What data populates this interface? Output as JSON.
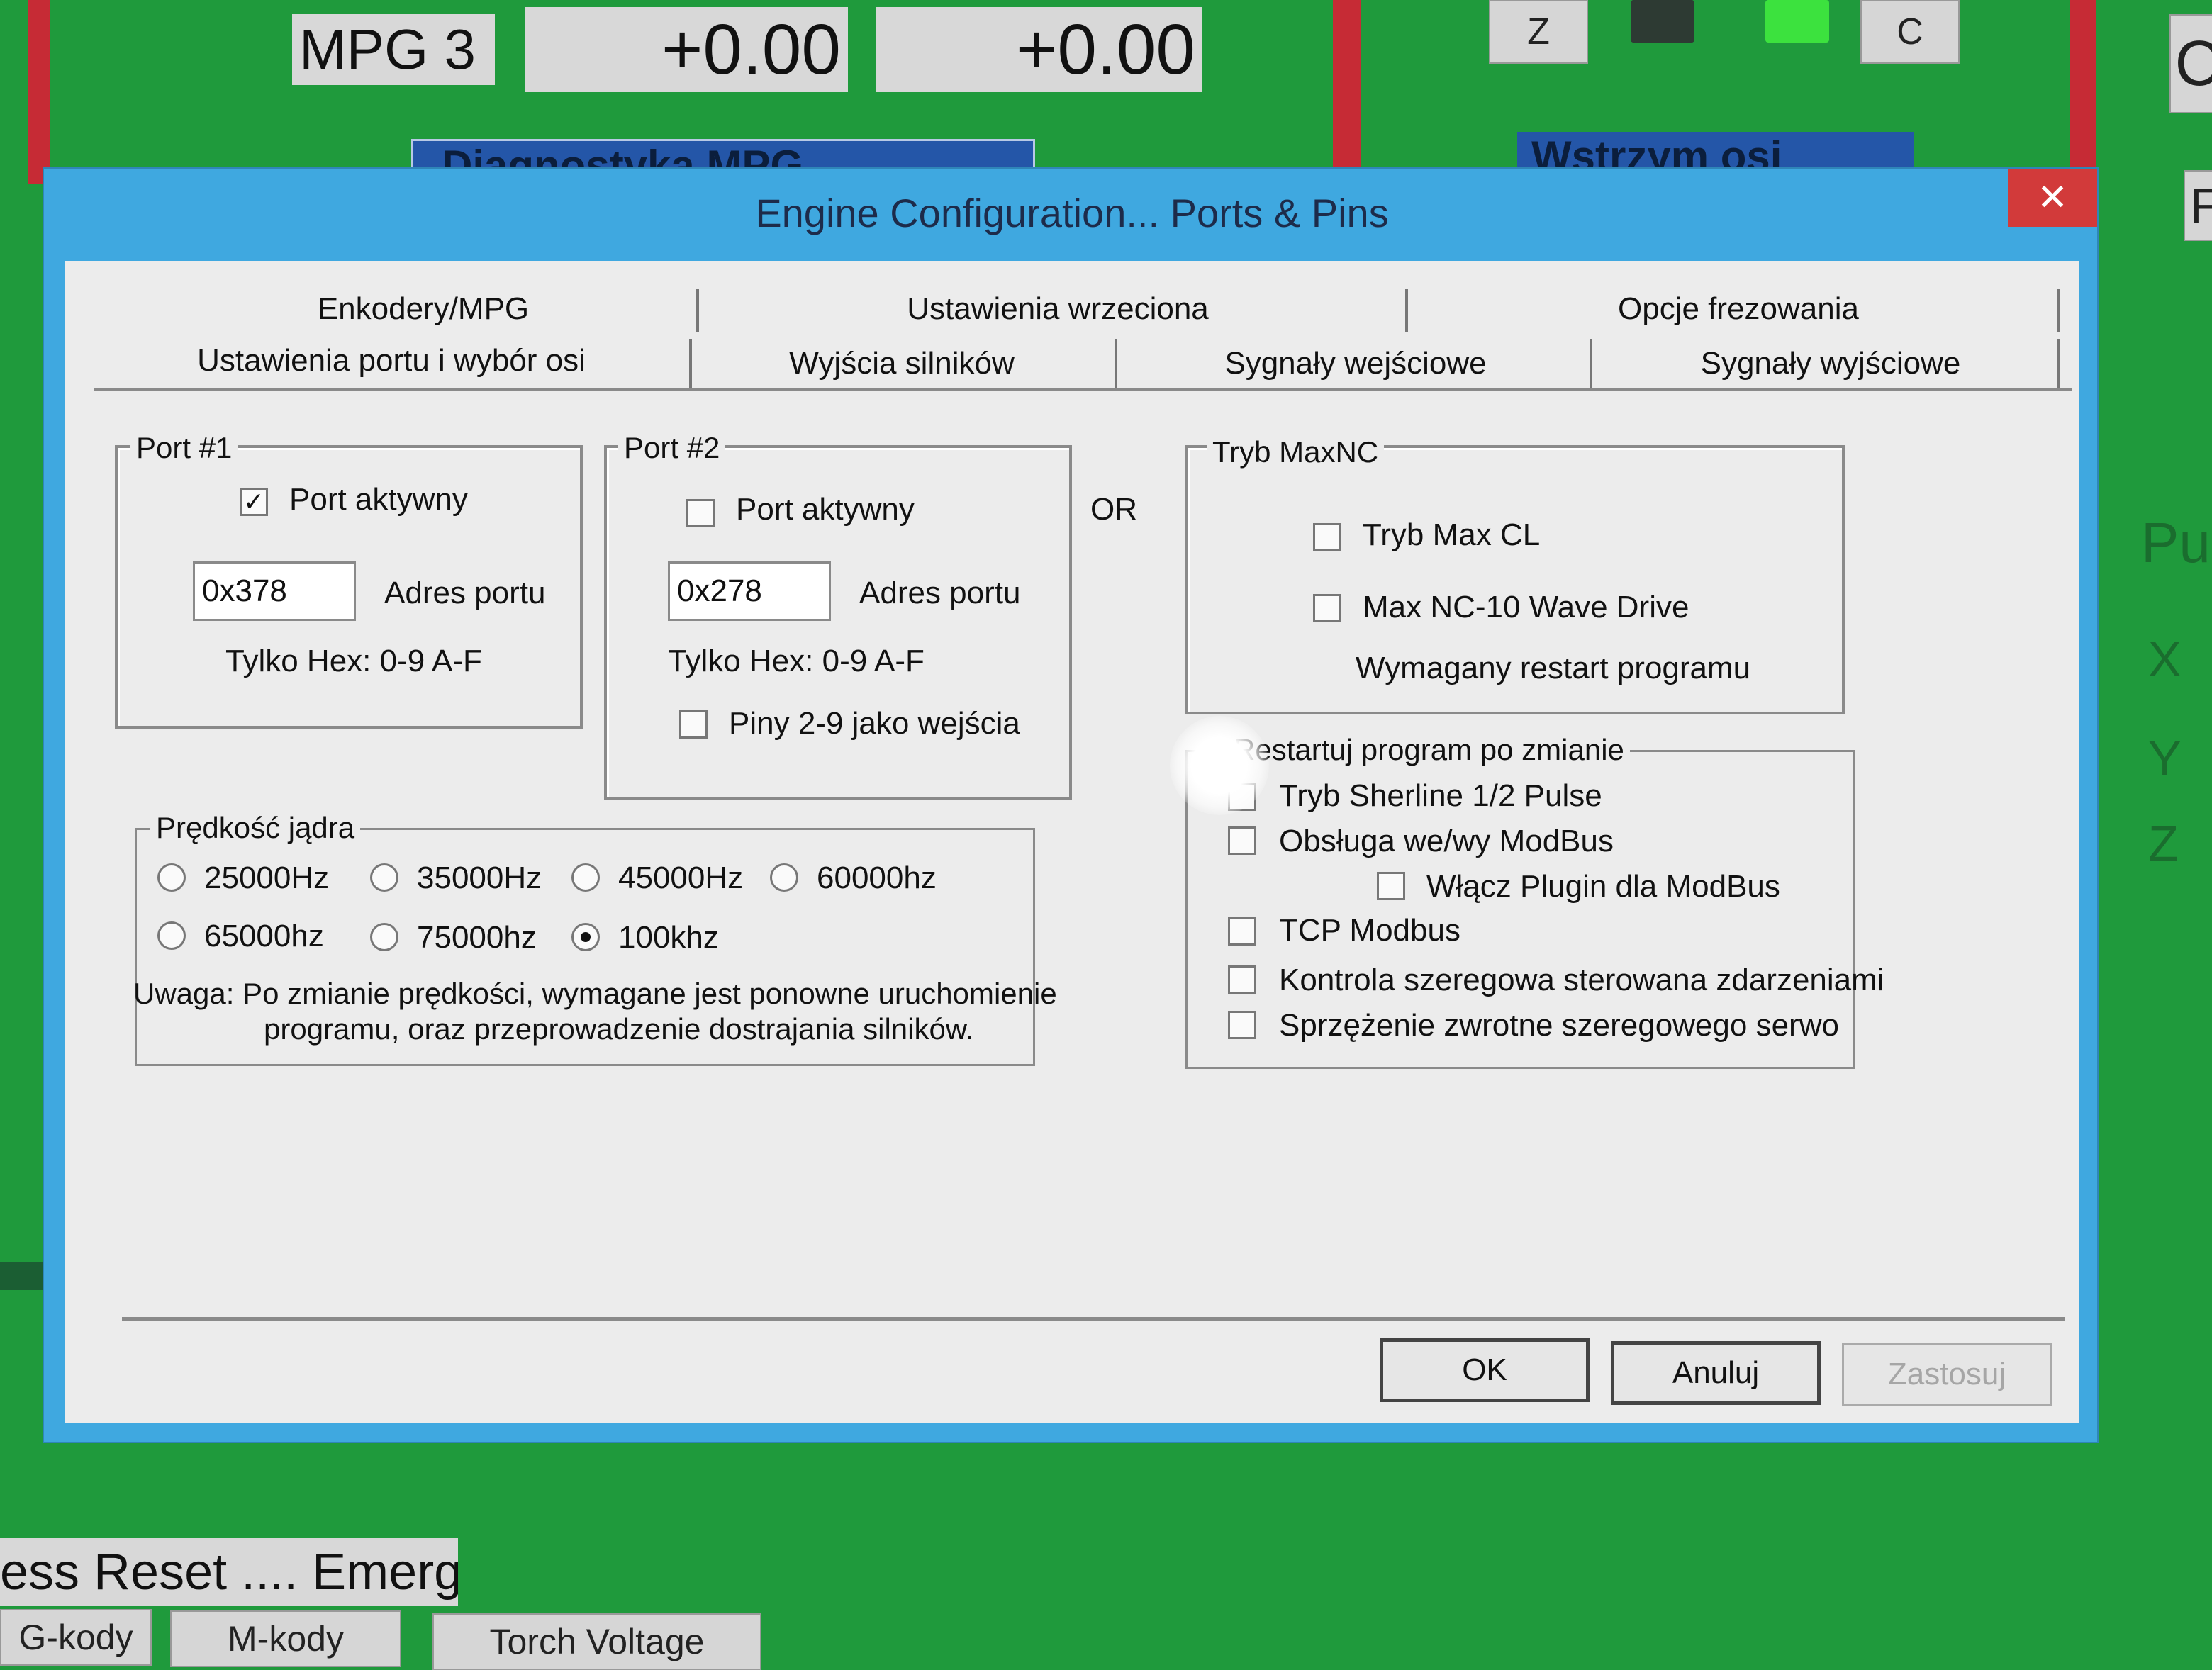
{
  "background": {
    "mpg_label": "MPG 3",
    "value_1": "+0.00",
    "value_2": "+0.00",
    "btn_z": "Z",
    "btn_c": "C",
    "header_1": "Diagnostyka MPG",
    "header_2": "Wstrzym osi",
    "right_label": "Pu",
    "axis_x": "X",
    "axis_y": "Y",
    "axis_z": "Z",
    "status_text": "ess Reset .... Emerg",
    "tabs": [
      "G-kody",
      "M-kody",
      "Torch Voltage"
    ],
    "right_top_char": "C",
    "right_mid_char": "F"
  },
  "dialog": {
    "title": "Engine Configuration... Ports & Pins",
    "close_glyph": "✕",
    "tabs_row1": [
      "Enkodery/MPG",
      "Ustawienia wrzeciona",
      "Opcje frezowania"
    ],
    "tabs_row2": [
      "Ustawienia portu i wybór osi",
      "Wyjścia silników",
      "Sygnały wejściowe",
      "Sygnały wyjściowe"
    ],
    "port1": {
      "legend": "Port #1",
      "active_label": "Port aktywny",
      "active_checked": true,
      "address": "0x378",
      "address_label": "Adres portu",
      "hex_hint": "Tylko Hex: 0-9 A-F"
    },
    "port2": {
      "legend": "Port #2",
      "active_label": "Port aktywny",
      "active_checked": false,
      "address": "0x278",
      "address_label": "Adres portu",
      "hex_hint": "Tylko Hex: 0-9 A-F",
      "pins_label": "Piny 2-9 jako wejścia"
    },
    "or_label": "OR",
    "maxnc": {
      "legend": "Tryb MaxNC",
      "max_cl": "Tryb Max CL",
      "wave_drive": "Max NC-10 Wave Drive",
      "restart_note": "Wymagany restart programu"
    },
    "options": {
      "legend": "Restartuj program po zmianie",
      "items": [
        "Tryb Sherline 1/2 Pulse",
        "Obsługa we/wy ModBus",
        "Włącz Plugin dla ModBus",
        "TCP Modbus",
        "Kontrola szeregowa sterowana zdarzeniami",
        "Sprzężenie zwrotne  szeregowego serwo"
      ]
    },
    "speed": {
      "legend": "Prędkość jądra",
      "options": [
        "25000Hz",
        "35000Hz",
        "45000Hz",
        "60000hz",
        "65000hz",
        "75000hz",
        "100khz"
      ],
      "selected": "100khz",
      "note_line1": "Uwaga: Po zmianie prędkości, wymagane jest ponowne uruchomienie",
      "note_line2": "programu, oraz przeprowadzenie dostrajania silników."
    },
    "buttons": {
      "ok": "OK",
      "cancel": "Anuluj",
      "apply": "Zastosuj"
    }
  },
  "colors": {
    "background_green": "#1f9a3c",
    "title_bar_blue": "#3fa8e0",
    "close_red": "#d23a3a",
    "accent_red": "#c62b35"
  }
}
